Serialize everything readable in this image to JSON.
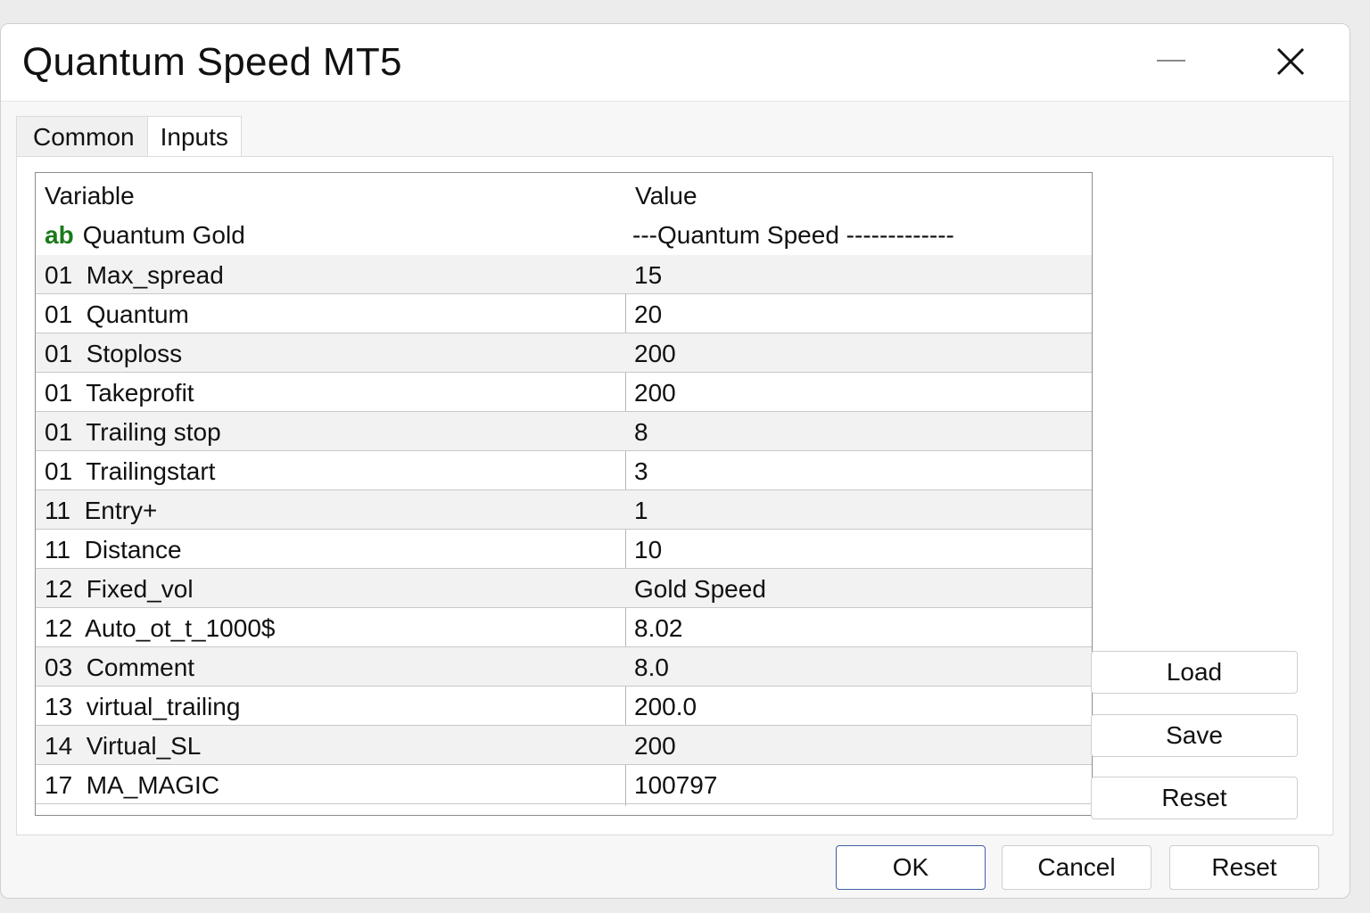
{
  "window": {
    "title": "Quantum Speed MT5"
  },
  "tabs": [
    {
      "label": "Common"
    },
    {
      "label": "Inputs"
    }
  ],
  "grid": {
    "col_variable": "Variable",
    "col_value": "Value",
    "group": {
      "type_badge": "ab",
      "name": "Quantum Gold",
      "value": "---Quantum Speed -------------"
    },
    "rows": [
      {
        "variable": "01  Max_spread",
        "value": "15"
      },
      {
        "variable": "01  Quantum",
        "value": "20"
      },
      {
        "variable": "01  Stoploss",
        "value": "200"
      },
      {
        "variable": "01  Takeprofit",
        "value": "200"
      },
      {
        "variable": "01  Trailing stop",
        "value": "8"
      },
      {
        "variable": "01  Trailingstart",
        "value": "3"
      },
      {
        "variable": "11  Entry+",
        "value": "1"
      },
      {
        "variable": "11  Distance",
        "value": "10"
      },
      {
        "variable": "12  Fixed_vol",
        "value": "Gold Speed"
      },
      {
        "variable": "12  Auto_ot_t_1000$",
        "value": "8.02"
      },
      {
        "variable": "03  Comment",
        "value": "8.0"
      },
      {
        "variable": "13  virtual_trailing",
        "value": "200.0"
      },
      {
        "variable": "14  Virtual_SL",
        "value": "200"
      },
      {
        "variable": "17  MA_MAGIC",
        "value": "100797"
      }
    ]
  },
  "side_buttons": {
    "load": "Load",
    "save": "Save",
    "reset": "Reset"
  },
  "footer_buttons": {
    "ok": "OK",
    "cancel": "Cancel",
    "reset": "Reset"
  },
  "colors": {
    "type_badge": "#1a7a1a",
    "primary_border": "#3f5fa0"
  },
  "icons": {
    "minimize": "minimize-icon",
    "close": "close-icon"
  }
}
